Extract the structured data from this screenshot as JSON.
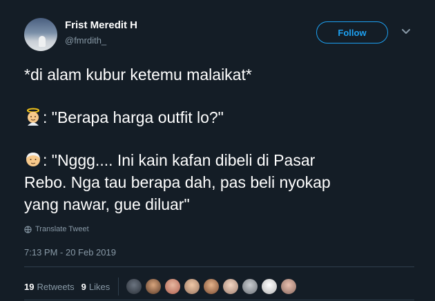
{
  "user": {
    "name": "Frist Meredit H",
    "handle": "@fmrdith_"
  },
  "follow_label": "Follow",
  "tweet": {
    "line1": "*di alam kubur ketemu malaikat*",
    "line2": ": \"Berapa harga outfit lo?\"",
    "line3": ": \"Nggg.... Ini kain kafan dibeli di Pasar",
    "line4": "Rebo. Nga tau berapa dah, pas beli nyokap",
    "line5": "yang nawar, gue diluar\""
  },
  "translate_label": "Translate Tweet",
  "timestamp": "7:13 PM - 20 Feb 2019",
  "stats": {
    "retweets_count": "19",
    "retweets_label": "Retweets",
    "likes_count": "9",
    "likes_label": "Likes"
  },
  "icons": {
    "chevron": "chevron-down-icon",
    "globe": "globe-icon",
    "angel_emoji": "angel-emoji",
    "old_man_emoji": "old-man-emoji"
  },
  "colors": {
    "background": "#141d26",
    "accent": "#1da1f2",
    "muted": "#8899a6"
  }
}
